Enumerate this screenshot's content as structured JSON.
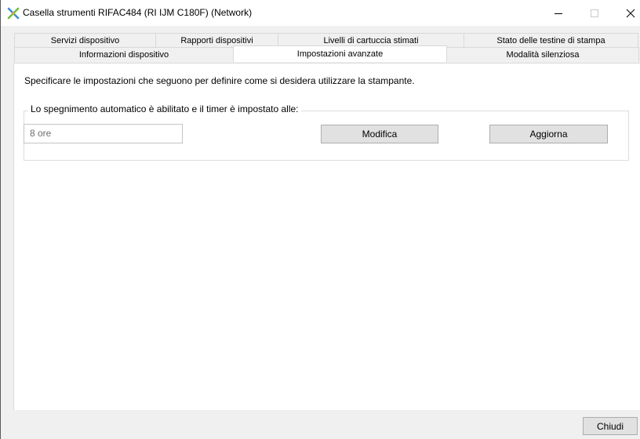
{
  "window": {
    "title": "Casella strumenti RIFAC484 (RI IJM C180F) (Network)",
    "icon": "printer-toolbox-icon"
  },
  "tabs": {
    "row1": [
      "Servizi dispositivo",
      "Rapporti dispositivi",
      "Livelli di cartuccia stimati",
      "Stato delle testine di stampa"
    ],
    "row2": [
      "Informazioni dispositivo",
      "Impostazioni avanzate",
      "Modalità silenziosa"
    ],
    "active": "Impostazioni avanzate"
  },
  "panel": {
    "description": "Specificare le impostazioni che seguono per definire come si desidera utilizzare la stampante.",
    "auto_off_group": {
      "label": "Lo spegnimento automatico è abilitato e il timer è impostato alle:",
      "timer_value": "8 ore",
      "modify_label": "Modifica",
      "refresh_label": "Aggiorna"
    }
  },
  "footer": {
    "close_label": "Chiudi"
  }
}
